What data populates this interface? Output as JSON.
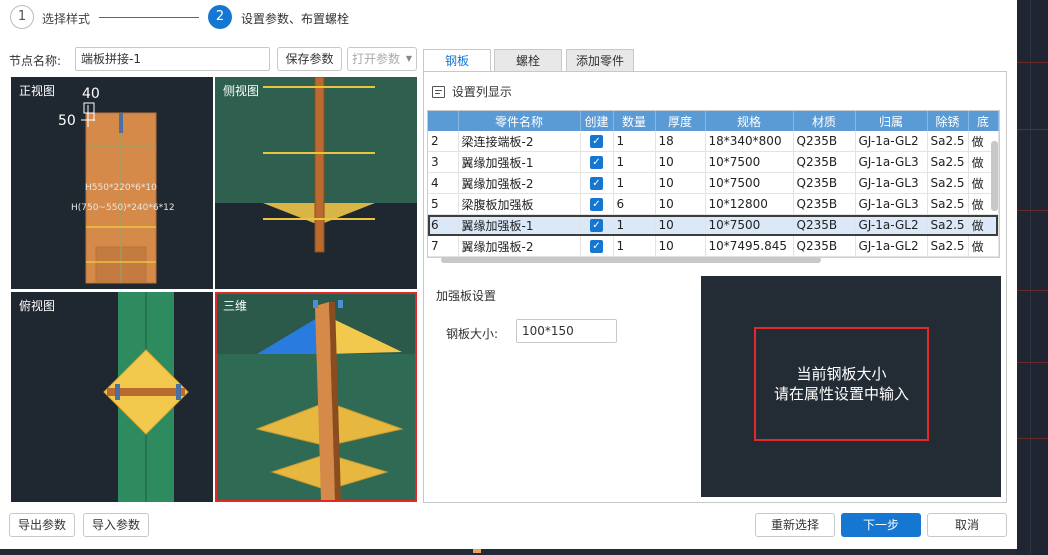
{
  "steps": [
    {
      "num": "1",
      "label": "选择样式"
    },
    {
      "num": "2",
      "label": "设置参数、布置螺栓"
    }
  ],
  "node": {
    "name_label": "节点名称:",
    "name_value": "端板拼接-1",
    "save_params": "保存参数",
    "open_params": "打开参数"
  },
  "tabs": [
    "钢板",
    "螺栓",
    "添加零件"
  ],
  "column_settings": "设置列显示",
  "views": {
    "front": "正视图",
    "side": "侧视图",
    "top": "俯视图",
    "threed": "三维",
    "dim_40": "40",
    "dim_50": "50",
    "h1": "H550*220*6*10",
    "h2": "H(750~550)*240*6*12"
  },
  "table": {
    "headers": [
      "",
      "零件名称",
      "创建",
      "数量",
      "厚度",
      "规格",
      "材质",
      "归属",
      "除锈",
      "底"
    ],
    "rows": [
      [
        "2",
        "梁连接端板-2",
        "✓",
        "1",
        "18",
        "18*340*800",
        "Q235B",
        "GJ-1a-GL2",
        "Sa2.5",
        "做"
      ],
      [
        "3",
        "翼缘加强板-1",
        "✓",
        "1",
        "10",
        "10*7500",
        "Q235B",
        "GJ-1a-GL3",
        "Sa2.5",
        "做"
      ],
      [
        "4",
        "翼缘加强板-2",
        "✓",
        "1",
        "10",
        "10*7500",
        "Q235B",
        "GJ-1a-GL3",
        "Sa2.5",
        "做"
      ],
      [
        "5",
        "梁腹板加强板",
        "✓",
        "6",
        "10",
        "10*12800",
        "Q235B",
        "GJ-1a-GL3",
        "Sa2.5",
        "做"
      ],
      [
        "6",
        "翼缘加强板-1",
        "✓",
        "1",
        "10",
        "10*7500",
        "Q235B",
        "GJ-1a-GL2",
        "Sa2.5",
        "做"
      ],
      [
        "7",
        "翼缘加强板-2",
        "✓",
        "1",
        "10",
        "10*7495.845",
        "Q235B",
        "GJ-1a-GL2",
        "Sa2.5",
        "做"
      ]
    ],
    "selected_index": 4
  },
  "stiffener": {
    "title": "加强板设置",
    "size_label": "钢板大小:",
    "size_value": "100*150"
  },
  "preview": {
    "line1": "当前钢板大小",
    "line2": "请在属性设置中输入"
  },
  "footer": {
    "export": "导出参数",
    "import": "导入参数",
    "reselect": "重新选择",
    "next": "下一步",
    "cancel": "取消"
  },
  "colors": {
    "accent": "#1677d2",
    "header_blue": "#5b9bd5",
    "view_bg": "#1f2731",
    "view_green": "#2e6b55",
    "plate_orange": "#d68a4a",
    "plate_yellow": "#f2c94c",
    "highlight_red": "#e02a2a"
  }
}
